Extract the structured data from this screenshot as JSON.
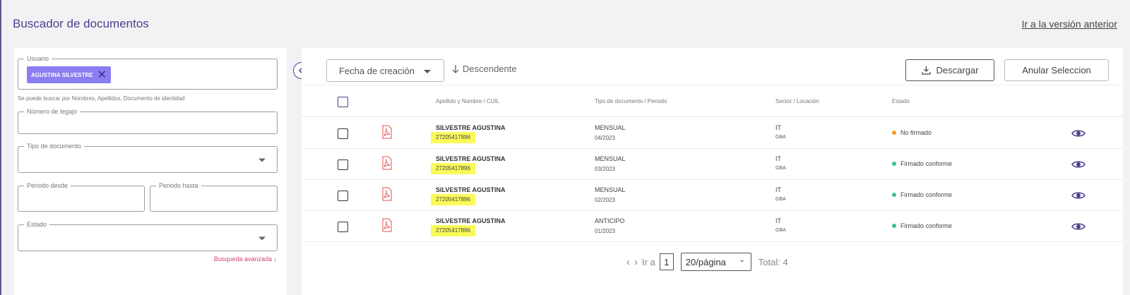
{
  "page": {
    "title": "Buscador de documentos",
    "previous_version_link": "Ir a la versión anterior"
  },
  "filters": {
    "usuario": {
      "label": "Usuario",
      "chip": "AGUSTINA SILVESTRE"
    },
    "usuario_helper": "Se puede buscar por Nombres, Apellidos, Documento de identidad",
    "legajo": {
      "label": "Número de legajo",
      "value": ""
    },
    "tipo_documento": {
      "label": "Tipo de documento",
      "value": ""
    },
    "periodo_desde": {
      "label": "Periodo desde",
      "value": ""
    },
    "periodo_hasta": {
      "label": "Periodo hasta",
      "value": ""
    },
    "estado": {
      "label": "Estado",
      "value": ""
    },
    "advanced_link": "Busqueda avanzada ↓"
  },
  "toolbar": {
    "sort_field": "Fecha de creación",
    "sort_direction": "Descendente",
    "download_label": "Descargar",
    "cancel_selection_label": "Anular Seleccion"
  },
  "table": {
    "headers": [
      "Apellido y Nombre / CUIL",
      "Tipo de documento / Periodo",
      "Sector / Locación",
      "Estado"
    ],
    "rows": [
      {
        "name": "SILVESTRE AGUSTINA",
        "cuil": "27205417896",
        "type": "MENSUAL",
        "period": "04/2023",
        "sector": "IT",
        "location": "GBA",
        "status": "No firmado",
        "status_color": "#f0a020"
      },
      {
        "name": "SILVESTRE AGUSTINA",
        "cuil": "27205417896",
        "type": "MENSUAL",
        "period": "03/2023",
        "sector": "IT",
        "location": "GBA",
        "status": "Firmado conforme",
        "status_color": "#3cc08a"
      },
      {
        "name": "SILVESTRE AGUSTINA",
        "cuil": "27205417896",
        "type": "MENSUAL",
        "period": "02/2023",
        "sector": "IT",
        "location": "GBA",
        "status": "Firmado conforme",
        "status_color": "#3cc08a"
      },
      {
        "name": "SILVESTRE AGUSTINA",
        "cuil": "27205417896",
        "type": "ANTICIPO",
        "period": "01/2023",
        "sector": "IT",
        "location": "GBA",
        "status": "Firmado conforme",
        "status_color": "#3cc08a"
      }
    ]
  },
  "pagination": {
    "goto_label": "Ir a",
    "current_page": "1",
    "per_page": "20/página",
    "total": "Total: 4"
  },
  "colors": {
    "accent": "#4a3f8c",
    "chip": "#8a7ef0",
    "highlight": "#fafa5a",
    "link_red": "#d0466a"
  }
}
